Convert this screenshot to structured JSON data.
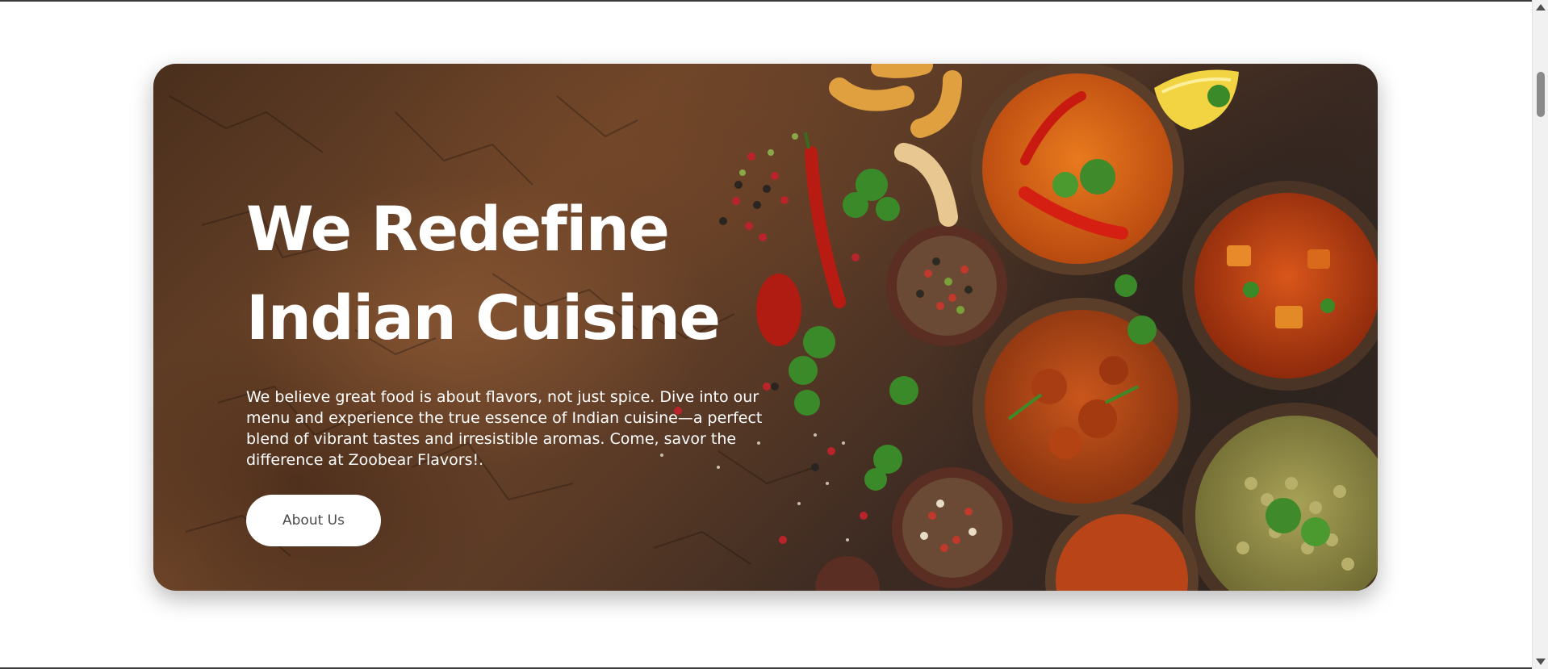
{
  "hero": {
    "title_line1": "We Redefine",
    "title_line2": "Indian Cuisine",
    "description": "We believe great food is about flavors, not just spice. Dive into our menu and experience the true essence of Indian cuisine—a perfect blend of vibrant tastes and irresistible aromas. Come, savor the difference at Zoobear Flavors!.",
    "button_label": "About Us"
  },
  "colors": {
    "button_bg": "#ffffff",
    "button_text": "#4a4a4a",
    "title_text": "#ffffff",
    "background_tone": "#5a3a26"
  }
}
